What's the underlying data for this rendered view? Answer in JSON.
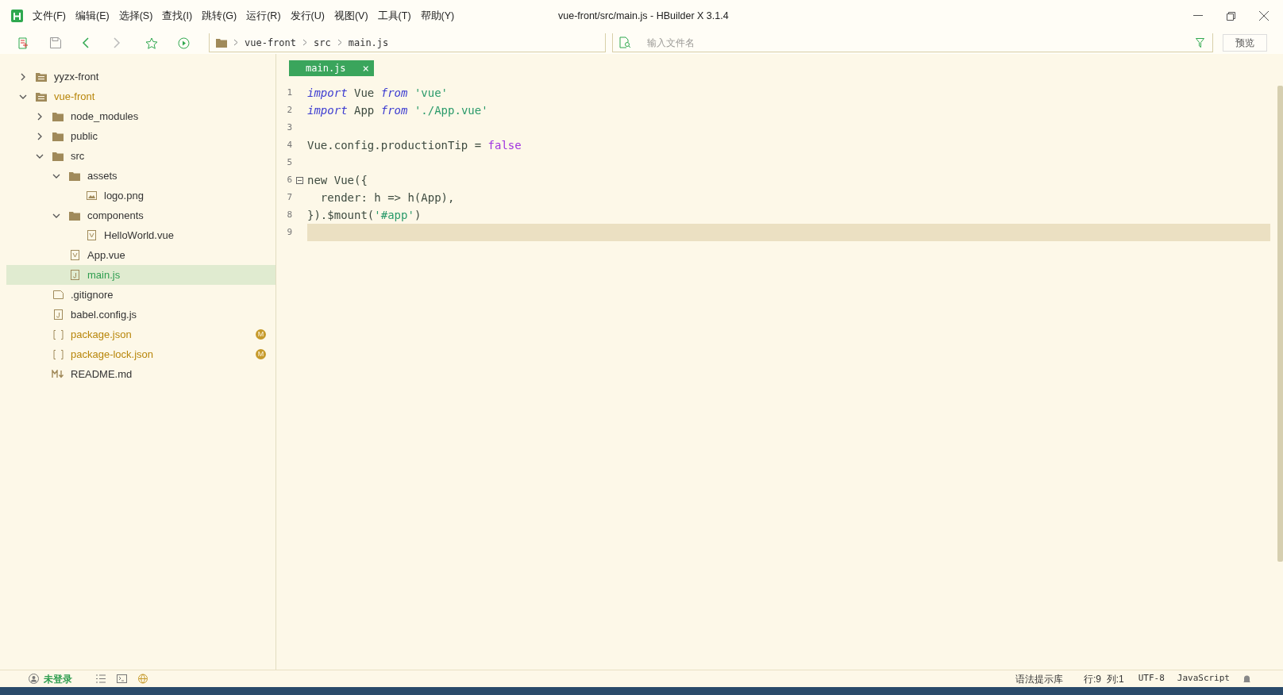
{
  "window": {
    "title": "vue-front/src/main.js - HBuilder X 3.1.4"
  },
  "menu": [
    "文件(F)",
    "编辑(E)",
    "选择(S)",
    "查找(I)",
    "跳转(G)",
    "运行(R)",
    "发行(U)",
    "视图(V)",
    "工具(T)",
    "帮助(Y)"
  ],
  "breadcrumb": [
    "vue-front",
    "src",
    "main.js"
  ],
  "file_search": {
    "placeholder": "输入文件名"
  },
  "preview_button": "预览",
  "tree": [
    {
      "name": "yyzx-front",
      "kind": "project",
      "expanded": false,
      "selected": false,
      "color": "#333333"
    },
    {
      "name": "vue-front",
      "kind": "project",
      "expanded": true,
      "selected": false,
      "color": "#b8860b",
      "children": [
        {
          "name": "node_modules",
          "kind": "folder",
          "expanded": false,
          "selected": false,
          "color": "#333333"
        },
        {
          "name": "public",
          "kind": "folder",
          "expanded": false,
          "selected": false,
          "color": "#333333"
        },
        {
          "name": "src",
          "kind": "folder",
          "expanded": true,
          "selected": false,
          "color": "#333333",
          "children": [
            {
              "name": "assets",
              "kind": "folder",
              "expanded": true,
              "selected": false,
              "color": "#333333",
              "children": [
                {
                  "name": "logo.png",
                  "kind": "image",
                  "selected": false,
                  "color": "#333333"
                }
              ]
            },
            {
              "name": "components",
              "kind": "folder",
              "expanded": true,
              "selected": false,
              "color": "#333333",
              "children": [
                {
                  "name": "HelloWorld.vue",
                  "kind": "vue",
                  "selected": false,
                  "color": "#333333"
                }
              ]
            },
            {
              "name": "App.vue",
              "kind": "vue",
              "selected": false,
              "color": "#333333"
            },
            {
              "name": "main.js",
              "kind": "js",
              "selected": true,
              "color": "#2e9d4f"
            }
          ]
        },
        {
          "name": ".gitignore",
          "kind": "file",
          "selected": false,
          "color": "#333333"
        },
        {
          "name": "babel.config.js",
          "kind": "js",
          "selected": false,
          "color": "#333333"
        },
        {
          "name": "package.json",
          "kind": "json",
          "selected": false,
          "color": "#b8860b",
          "badge": "M"
        },
        {
          "name": "package-lock.json",
          "kind": "json",
          "selected": false,
          "color": "#b8860b",
          "badge": "M"
        },
        {
          "name": "README.md",
          "kind": "md",
          "selected": false,
          "color": "#333333"
        }
      ]
    }
  ],
  "tabs": [
    {
      "label": "main.js",
      "close": "×",
      "selected": true
    }
  ],
  "code": [
    {
      "number": "1",
      "tokens": [
        {
          "kind": "keyword",
          "text": "import"
        },
        {
          "kind": "plain",
          "text": " Vue "
        },
        {
          "kind": "keyword",
          "text": "from"
        },
        {
          "kind": "string",
          "text": " 'vue'"
        }
      ]
    },
    {
      "number": "2",
      "tokens": [
        {
          "kind": "keyword",
          "text": "import"
        },
        {
          "kind": "plain",
          "text": " App "
        },
        {
          "kind": "keyword",
          "text": "from"
        },
        {
          "kind": "string",
          "text": " './App.vue'"
        }
      ]
    },
    {
      "number": "3"
    },
    {
      "number": "4",
      "tokens": [
        {
          "kind": "plain",
          "text": "Vue.config.productionTip "
        },
        {
          "kind": "operator",
          "text": "="
        },
        {
          "kind": "boolean",
          "text": " false"
        }
      ]
    },
    {
      "number": "5"
    },
    {
      "number": "6",
      "fold": true,
      "tokens": [
        {
          "kind": "plain",
          "text": "new Vue({"
        }
      ]
    },
    {
      "number": "7",
      "tokens": [
        {
          "kind": "plain",
          "text": "  render: h "
        },
        {
          "kind": "operator",
          "text": "=>"
        },
        {
          "kind": "plain",
          "text": " h(App),"
        }
      ]
    },
    {
      "number": "8",
      "tokens": [
        {
          "kind": "plain",
          "text": "}).$mount("
        },
        {
          "kind": "string",
          "text": "'#app'"
        },
        {
          "kind": "plain",
          "text": ")"
        }
      ]
    },
    {
      "number": "9",
      "current": true
    }
  ],
  "status_bar": {
    "login": "未登录",
    "syntax": "语法提示库",
    "position": "行:9  列:1",
    "encoding": "UTF-8",
    "language": "JavaScript"
  }
}
